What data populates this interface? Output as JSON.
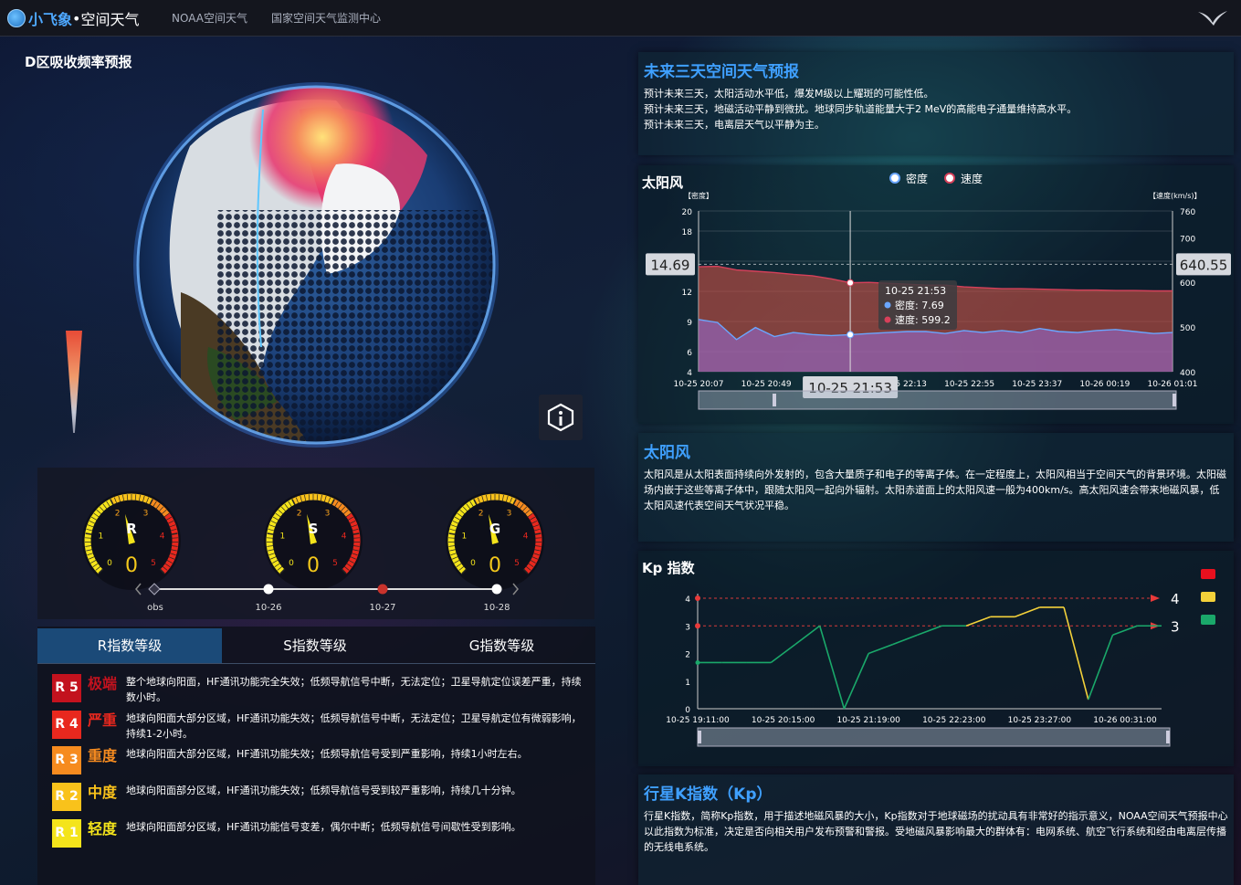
{
  "header": {
    "logo_prefix": "小飞象",
    "logo_suffix": "空间天气",
    "links": [
      "NOAA空间天气",
      "国家空间天气监测中心"
    ]
  },
  "left": {
    "map_title": "D区吸收频率预报",
    "gauges": [
      {
        "letter": "R",
        "value": "0"
      },
      {
        "letter": "S",
        "value": "0"
      },
      {
        "letter": "G",
        "value": "0"
      }
    ],
    "gauge_ticks": [
      "0",
      "1",
      "2",
      "3",
      "4",
      "5"
    ],
    "timeline": [
      "obs",
      "10-26",
      "10-27",
      "10-28"
    ],
    "tabs": [
      "R指数等级",
      "S指数等级",
      "G指数等级"
    ],
    "levels": [
      {
        "code": "R 5",
        "name": "极端",
        "color": "#c3121e",
        "bg": "#c3121e",
        "desc": "整个地球向阳面，HF通讯功能完全失效；低频导航信号中断，无法定位；卫星导航定位误差严重，持续数小时。"
      },
      {
        "code": "R 4",
        "name": "严重",
        "color": "#e8281e",
        "bg": "#e8281e",
        "desc": "地球向阳面大部分区域，HF通讯功能失效；低频导航信号中断，无法定位；卫星导航定位有微弱影响，持续1-2小时。"
      },
      {
        "code": "R 3",
        "name": "重度",
        "color": "#f68b1f",
        "bg": "#f68b1f",
        "desc": "地球向阳面大部分区域，HF通讯功能失效；低频导航信号受到严重影响，持续1小时左右。"
      },
      {
        "code": "R 2",
        "name": "中度",
        "color": "#f9c21b",
        "bg": "#f9c21b",
        "desc": "地球向阳面部分区域，HF通讯功能失效；低频导航信号受到较严重影响，持续几十分钟。"
      },
      {
        "code": "R 1",
        "name": "轻度",
        "color": "#f4e41b",
        "bg": "#f4e41b",
        "desc": "地球向阳面部分区域，HF通讯功能信号变差，偶尔中断；低频导航信号间歇性受到影响。"
      }
    ]
  },
  "forecast": {
    "title": "未来三天空间天气预报",
    "lines": [
      "预计未来三天，太阳活动水平低，爆发M级以上耀斑的可能性低。",
      "预计未来三天，地磁活动平静到微扰。地球同步轨道能量大于2 MeV的高能电子通量维持高水平。",
      "预计未来三天，电离层天气以平静为主。"
    ]
  },
  "solar_wind_chart": {
    "chart_data": {
      "type": "line",
      "title": "太阳风",
      "legend": [
        "密度",
        "速度"
      ],
      "y_left_label": "【密度】",
      "y_right_label": "【速度(km/s)】",
      "y_left_ticks": [
        "4",
        "6",
        "9",
        "12",
        "15",
        "18",
        "20"
      ],
      "y_right_ticks": [
        "400",
        "500",
        "600",
        "700",
        "760"
      ],
      "x_ticks": [
        "10-25 20:07",
        "10-25 20:49",
        "10-25 21:31",
        "10-25 22:13",
        "10-25 22:55",
        "10-25 23:37",
        "10-26 00:19",
        "10-26 01:01"
      ],
      "series": [
        {
          "name": "密度",
          "color": "#6aa6ff",
          "values": [
            9.2,
            8.9,
            7.2,
            8.4,
            7.5,
            7.9,
            7.7,
            7.6,
            7.69,
            7.8,
            7.9,
            8.0,
            8.0,
            7.8,
            8.1,
            7.9,
            8.1,
            7.9,
            8.3,
            8.0,
            7.9,
            8.1,
            8.2,
            8.0,
            7.8,
            7.9
          ]
        },
        {
          "name": "速度",
          "color": "#d6405a",
          "values": [
            635,
            636,
            628,
            625,
            622,
            618,
            615,
            608,
            599.2,
            600,
            598,
            596,
            594,
            594,
            590,
            588,
            586,
            586,
            585,
            584,
            583,
            583,
            582,
            582,
            581,
            581
          ]
        }
      ],
      "cursor_time": "10-25 21:53",
      "tooltip": {
        "time": "10-25 21:53",
        "density_label": "密度: 7.69",
        "speed_label": "速度: 599.2"
      },
      "left_readout": "14.69",
      "right_readout": "640.55"
    }
  },
  "solar_wind_info": {
    "title": "太阳风",
    "text": "太阳风是从太阳表面持续向外发射的，包含大量质子和电子的等离子体。在一定程度上，太阳风相当于空间天气的背景环境。太阳磁场内嵌于这些等离子体中，跟随太阳风一起向外辐射。太阳赤道面上的太阳风速一般为400km/s。高太阳风速会带来地磁风暴，低太阳风速代表空间天气状况平稳。"
  },
  "kp_chart": {
    "chart_data": {
      "type": "line",
      "title": "Kp 指数",
      "y_ticks": [
        "0",
        "1",
        "2",
        "3",
        "4"
      ],
      "x_ticks": [
        "10-25 19:11:00",
        "10-25 20:15:00",
        "10-25 21:19:00",
        "10-25 22:23:00",
        "10-25 23:27:00",
        "10-26 00:31:00"
      ],
      "threshold_labels": [
        "4",
        "3"
      ],
      "legend_colors": [
        "#e8101e",
        "#f3d13a",
        "#1aa86a"
      ],
      "series": [
        {
          "name": "Kp",
          "values": [
            1.67,
            1.67,
            1.67,
            1.67,
            2.33,
            3.0,
            0.0,
            2.0,
            2.33,
            2.67,
            3.0,
            3.0,
            3.33,
            3.33,
            3.67,
            3.67,
            0.33,
            2.67,
            3.0,
            3.0
          ]
        }
      ]
    }
  },
  "kp_info": {
    "title": "行星K指数（Kp）",
    "text": "行星K指数，简称Kp指数，用于描述地磁风暴的大小，Kp指数对于地球磁场的扰动具有非常好的指示意义，NOAA空间天气预报中心以此指数为标准，决定是否向相关用户发布预警和警报。受地磁风暴影响最大的群体有：电网系统、航空飞行系统和经由电离层传播的无线电系统。"
  }
}
